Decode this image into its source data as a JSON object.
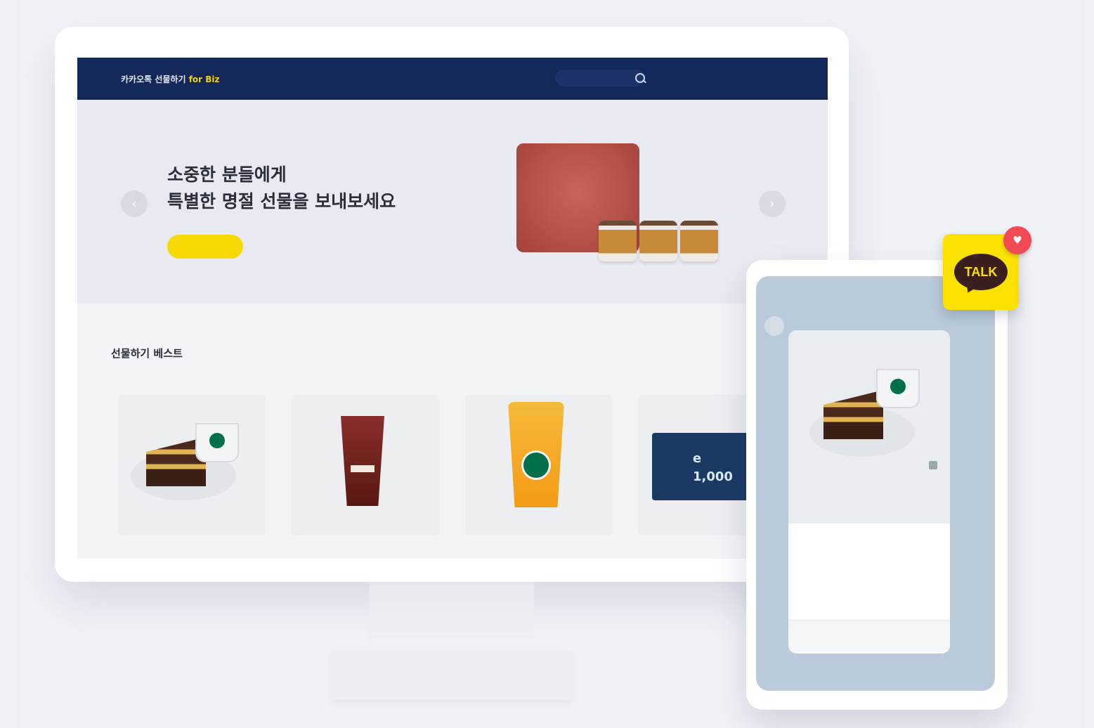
{
  "nav": {
    "logo_main": "카카오톡 선물하기",
    "logo_highlight": "for Biz",
    "menu": [
      "",
      "",
      ""
    ],
    "right_links": [
      "",
      "",
      ""
    ]
  },
  "hero": {
    "eyebrow": "",
    "title": "소중한 분들에게\n특별한 명절 선물을 보내보세요",
    "cta": ""
  },
  "best": {
    "title": "선물하기 베스트",
    "cards": [
      {
        "label": ""
      },
      {
        "label": ""
      },
      {
        "label": ""
      },
      {
        "label": ""
      }
    ],
    "giftcard_text": "e\n1,000"
  },
  "chat": {
    "title": "",
    "sender": "",
    "brand": "",
    "product": "",
    "heading": "",
    "body": "",
    "button": ""
  },
  "talk_badge": {
    "label": "TALK"
  },
  "icons": {
    "left_arrow": "chevron-left-icon",
    "right_arrow": "chevron-right-icon",
    "search": "search-icon",
    "notification": "heart-icon"
  },
  "colors": {
    "nav": "#15285a",
    "accent_yellow": "#f6d900",
    "kakao_yellow": "#fae100",
    "notif_red": "#f04a55"
  }
}
